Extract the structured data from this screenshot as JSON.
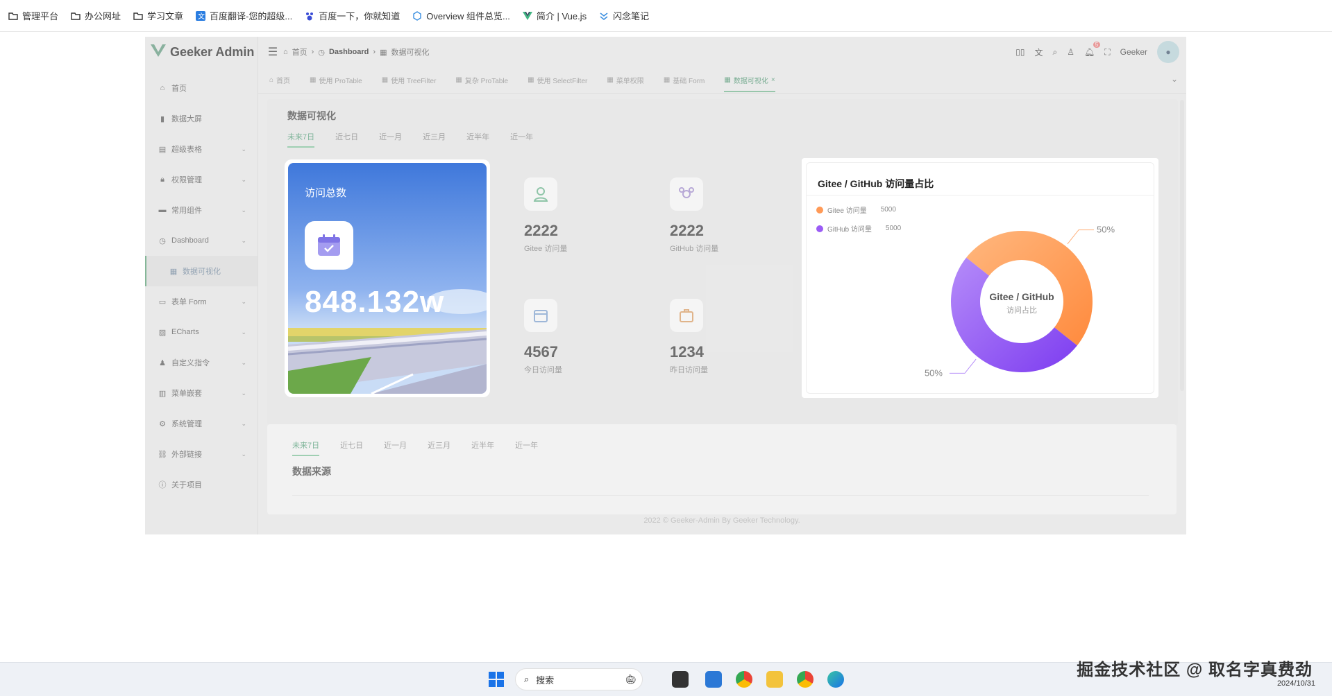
{
  "bookmarks": [
    {
      "label": "管理平台",
      "icon": "folder-icon"
    },
    {
      "label": "办公网址",
      "icon": "folder-icon"
    },
    {
      "label": "学习文章",
      "icon": "folder-icon"
    },
    {
      "label": "百度翻译-您的超级...",
      "icon": "translate-icon"
    },
    {
      "label": "百度一下，你就知道",
      "icon": "baidu-icon"
    },
    {
      "label": "Overview 组件总览...",
      "icon": "overview-icon"
    },
    {
      "label": "简介 | Vue.js",
      "icon": "vue-icon"
    },
    {
      "label": "闪念笔记",
      "icon": "note-icon"
    }
  ],
  "app": {
    "logo_text": "Geeker Admin",
    "user_name": "Geeker",
    "notification_count": "5"
  },
  "breadcrumb": [
    "首页",
    "Dashboard",
    "数据可视化"
  ],
  "sidebar": {
    "items": [
      {
        "label": "首页",
        "icon": "home-icon",
        "expandable": false
      },
      {
        "label": "数据大屏",
        "icon": "bar-chart-icon",
        "expandable": false
      },
      {
        "label": "超级表格",
        "icon": "table-icon",
        "expandable": true
      },
      {
        "label": "权限管理",
        "icon": "lock-icon",
        "expandable": true
      },
      {
        "label": "常用组件",
        "icon": "briefcase-icon",
        "expandable": true
      },
      {
        "label": "Dashboard",
        "icon": "gauge-icon",
        "expandable": true
      },
      {
        "label": "数据可视化",
        "icon": "grid-icon",
        "expandable": false,
        "active": true
      },
      {
        "label": "表单 Form",
        "icon": "form-icon",
        "expandable": true
      },
      {
        "label": "ECharts",
        "icon": "chart-icon",
        "expandable": true
      },
      {
        "label": "自定义指令",
        "icon": "user-icon",
        "expandable": true
      },
      {
        "label": "菜单嵌套",
        "icon": "menu-icon",
        "expandable": true
      },
      {
        "label": "系统管理",
        "icon": "gear-icon",
        "expandable": true
      },
      {
        "label": "外部链接",
        "icon": "link-icon",
        "expandable": true
      },
      {
        "label": "关于项目",
        "icon": "info-icon",
        "expandable": false
      }
    ]
  },
  "tabs": [
    {
      "label": "首页"
    },
    {
      "label": "使用 ProTable"
    },
    {
      "label": "使用 TreeFilter"
    },
    {
      "label": "复杂 ProTable"
    },
    {
      "label": "使用 SelectFilter"
    },
    {
      "label": "菜单权限"
    },
    {
      "label": "基础 Form"
    },
    {
      "label": "数据可视化",
      "active": true
    }
  ],
  "page": {
    "title": "数据可视化",
    "ranges": [
      "未来7日",
      "近七日",
      "近一月",
      "近三月",
      "近半年",
      "近一年"
    ],
    "active_range": "未来7日"
  },
  "hero": {
    "title": "访问总数",
    "value": "848.132w"
  },
  "stats": [
    {
      "value": "2222",
      "label": "Gitee 访问量",
      "icon": "person-icon",
      "bg": "#e4eee7"
    },
    {
      "value": "2222",
      "label": "GitHub 访问量",
      "icon": "team-icon",
      "bg": "#e1dde8"
    },
    {
      "value": "4567",
      "label": "今日访问量",
      "icon": "calendar-icon",
      "bg": "#efe7df"
    },
    {
      "value": "1234",
      "label": "昨日访问量",
      "icon": "briefcase-icon",
      "bg": "#e9e9e3"
    }
  ],
  "pie": {
    "title": "Gitee / GitHub 访问量占比",
    "center_title": "Gitee / GitHub",
    "center_sub": "访问占比",
    "legend": [
      {
        "name": "Gitee 访问量",
        "value": "5000",
        "color": "#ff9a57"
      },
      {
        "name": "GitHub 访问量",
        "value": "5000",
        "color": "#9b5cf5"
      }
    ],
    "labels": [
      "50%",
      "50%"
    ]
  },
  "chart_data": {
    "type": "pie",
    "title": "Gitee / GitHub 访问量占比",
    "categories": [
      "Gitee 访问量",
      "GitHub 访问量"
    ],
    "values": [
      5000,
      5000
    ]
  },
  "source": {
    "ranges": [
      "未来7日",
      "近七日",
      "近一月",
      "近三月",
      "近半年",
      "近一年"
    ],
    "active_range": "未来7日",
    "title": "数据来源"
  },
  "footer": "2022 © Geeker-Admin By Geeker Technology.",
  "taskbar": {
    "search_label": "搜索",
    "date": "2024/10/31"
  },
  "watermark": "掘金技术社区 @ 取名字真费劲"
}
